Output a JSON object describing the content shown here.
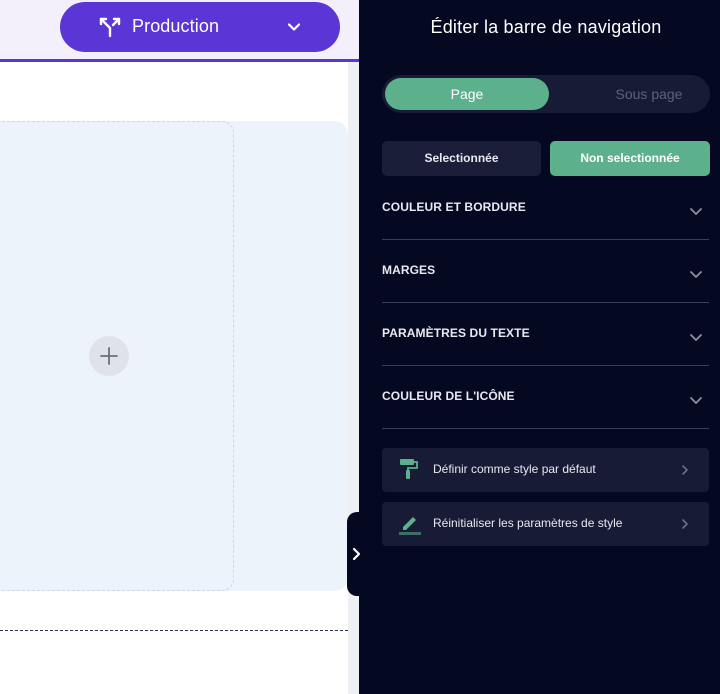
{
  "header": {
    "environment_label": "Production",
    "env_icon": "branch-icon",
    "dropdown_icon": "chevron-down-icon"
  },
  "canvas": {
    "add_icon": "plus-icon"
  },
  "panel": {
    "title": "Éditer la barre de navigation",
    "tabs": [
      {
        "label": "Page",
        "active": true
      },
      {
        "label": "Sous page",
        "active": false
      }
    ],
    "state_buttons": [
      {
        "label": "Selectionnée",
        "active": false
      },
      {
        "label": "Non selectionnée",
        "active": true
      }
    ],
    "sections": [
      {
        "label": "COULEUR ET BORDURE"
      },
      {
        "label": "MARGES"
      },
      {
        "label": "PARAMÈTRES DU TEXTE"
      },
      {
        "label": "COULEUR DE L'ICÔNE"
      }
    ],
    "actions": [
      {
        "label": "Définir comme style par défaut",
        "icon": "paint-roller-icon"
      },
      {
        "label": "Réinitialiser les paramètres de style",
        "icon": "pencil-icon"
      }
    ],
    "collapse_icon": "chevron-right-icon"
  },
  "colors": {
    "accent_purple": "#5b35d5",
    "accent_green": "#5cb08c",
    "panel_bg": "#050821",
    "canvas_section_bg": "#edf3fb"
  }
}
